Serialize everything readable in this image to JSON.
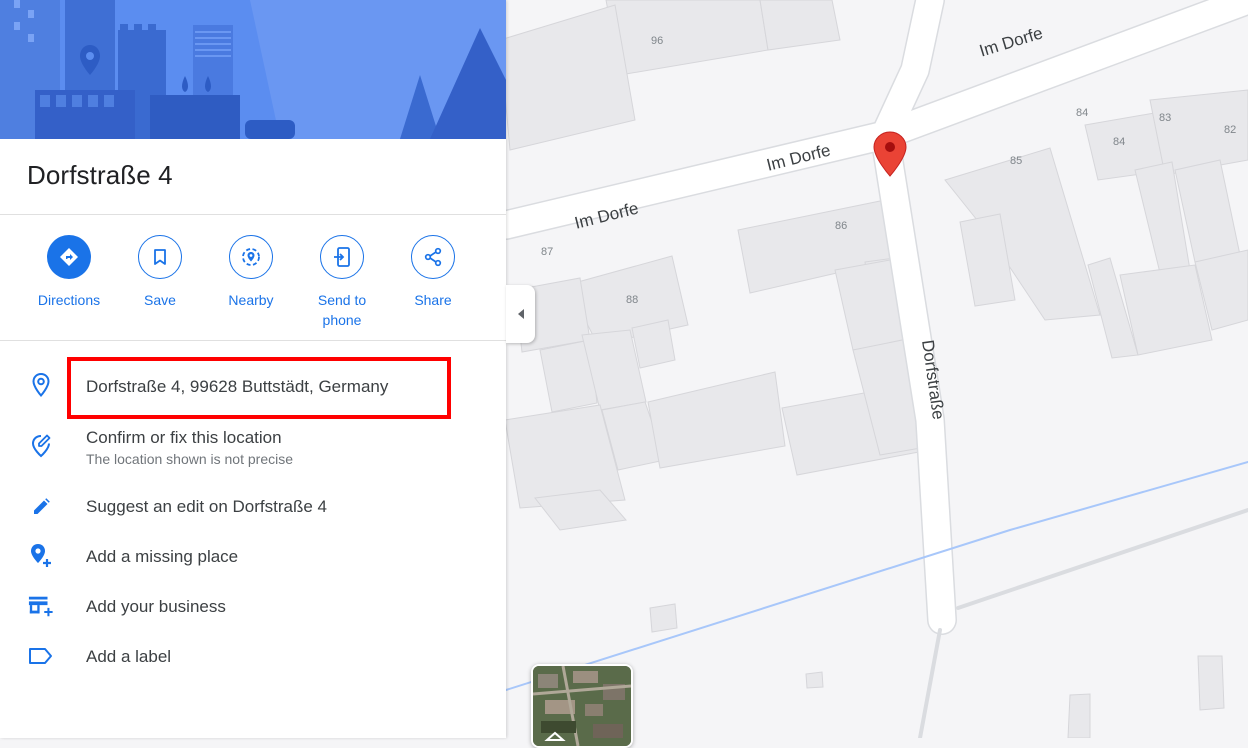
{
  "place": {
    "title": "Dorfstraße 4"
  },
  "actions": [
    {
      "label": "Directions",
      "icon": "directions-icon"
    },
    {
      "label": "Save",
      "icon": "bookmark-icon"
    },
    {
      "label": "Nearby",
      "icon": "nearby-icon"
    },
    {
      "label": "Send to phone",
      "icon": "send-to-phone-icon"
    },
    {
      "label": "Share",
      "icon": "share-icon"
    }
  ],
  "details": {
    "address": "Dorfstraße 4, 99628 Buttstädt, Germany",
    "confirm": {
      "title": "Confirm or fix this location",
      "subtitle": "The location shown is not precise"
    },
    "suggest_edit": "Suggest an edit on Dorfstraße 4",
    "add_missing_place": "Add a missing place",
    "add_business": "Add your business",
    "add_label": "Add a label"
  },
  "map": {
    "street_labels": [
      "Im Dorfe",
      "Im Dorfe",
      "Im Dorfe",
      "Dorfstraße"
    ],
    "house_numbers": [
      "96",
      "84",
      "83",
      "82",
      "84",
      "85",
      "86",
      "87",
      "88"
    ]
  },
  "colors": {
    "accent": "#1a73e8",
    "highlight": "#ff0000",
    "marker": "#ea4335",
    "hero": "#5b8df0"
  }
}
